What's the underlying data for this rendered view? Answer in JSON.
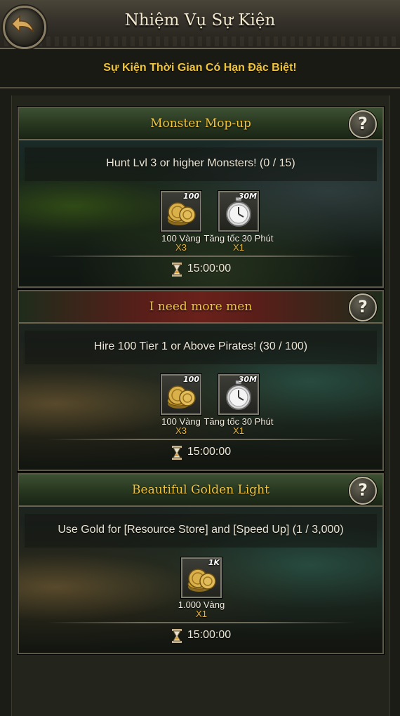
{
  "header": {
    "title": "Nhiệm Vụ Sự Kiện",
    "subtitle": "Sự Kiện Thời Gian Có Hạn Đặc Biệt!"
  },
  "events": [
    {
      "title": "Monster Mop-up",
      "task": "Hunt Lvl 3 or higher Monsters! (0 / 15)",
      "help": "?",
      "rewards": [
        {
          "icon": "gold-coins-icon",
          "qty_tag": "100",
          "name": "100 Vàng",
          "mult": "X3"
        },
        {
          "icon": "stopwatch-icon",
          "qty_tag": "30M",
          "name": "Tăng tốc 30 Phút",
          "mult": "X1"
        }
      ],
      "timer": "15:00:00"
    },
    {
      "title": "I need more men",
      "task": "Hire 100 Tier 1 or Above Pirates!  (30 / 100)",
      "help": "?",
      "rewards": [
        {
          "icon": "gold-coins-icon",
          "qty_tag": "100",
          "name": "100 Vàng",
          "mult": "X3"
        },
        {
          "icon": "stopwatch-icon",
          "qty_tag": "30M",
          "name": "Tăng tốc 30 Phút",
          "mult": "X1"
        }
      ],
      "timer": "15:00:00"
    },
    {
      "title": "Beautiful Golden Light",
      "task": "Use Gold for [Resource Store] and [Speed Up] (1 / 3,000)",
      "help": "?",
      "rewards": [
        {
          "icon": "gold-coins-icon",
          "qty_tag": "1K",
          "name": "1.000 Vàng",
          "mult": "X1"
        }
      ],
      "timer": "15:00:00"
    }
  ],
  "colors": {
    "title_gold": "#f1c53a",
    "mult_gold": "#e6b43a",
    "header_green": "#26361f",
    "header_red": "#6a211b"
  }
}
